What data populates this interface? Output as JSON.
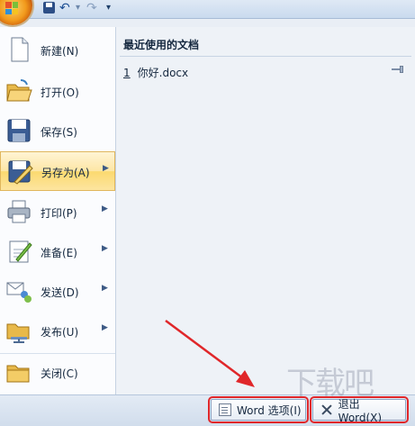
{
  "quick_access": {
    "undo_icon": "undo-icon",
    "redo_icon": "redo-icon"
  },
  "menu": {
    "items": [
      {
        "label": "新建(N)",
        "icon": "new-document-icon",
        "has_submenu": false
      },
      {
        "label": "打开(O)",
        "icon": "open-folder-icon",
        "has_submenu": false
      },
      {
        "label": "保存(S)",
        "icon": "save-disk-icon",
        "has_submenu": false
      },
      {
        "label": "另存为(A)",
        "icon": "save-as-icon",
        "has_submenu": true,
        "active": true
      },
      {
        "label": "打印(P)",
        "icon": "printer-icon",
        "has_submenu": true
      },
      {
        "label": "准备(E)",
        "icon": "prepare-icon",
        "has_submenu": true
      },
      {
        "label": "发送(D)",
        "icon": "send-icon",
        "has_submenu": true
      },
      {
        "label": "发布(U)",
        "icon": "publish-icon",
        "has_submenu": true
      },
      {
        "label": "关闭(C)",
        "icon": "close-folder-icon",
        "has_submenu": false
      }
    ]
  },
  "recent": {
    "header": "最近使用的文档",
    "items": [
      {
        "number": "1",
        "name": "你好.docx"
      }
    ]
  },
  "footer": {
    "options_label": "Word 选项(I)",
    "exit_label": "退出 Word(X)"
  },
  "watermark": "下载吧",
  "colors": {
    "accent": "#fbd96f",
    "highlight_border": "#e0272a",
    "panel_bg": "#eef2f7"
  }
}
